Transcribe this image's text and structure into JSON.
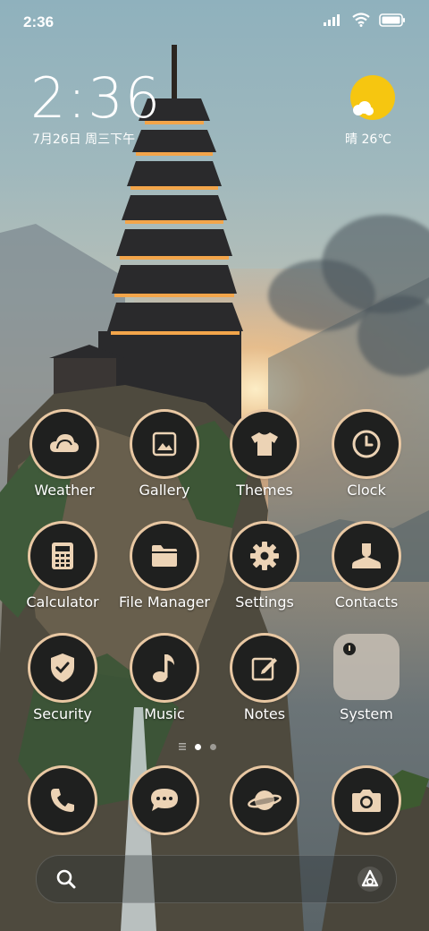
{
  "status_bar": {
    "time": "2:36",
    "signal": "signal-icon",
    "wifi": "wifi-icon",
    "battery": "battery-icon"
  },
  "clock_widget": {
    "time": "2:36",
    "date": "7月26日 周三下午"
  },
  "weather_widget": {
    "condition_icon": "sun-cloud-icon",
    "text": "晴 26℃"
  },
  "apps_row1": [
    {
      "label": "Weather",
      "icon": "weather-cloud-icon"
    },
    {
      "label": "Gallery",
      "icon": "gallery-icon"
    },
    {
      "label": "Themes",
      "icon": "tshirt-icon"
    },
    {
      "label": "Clock",
      "icon": "clock-icon"
    }
  ],
  "apps_row2": [
    {
      "label": "Calculator",
      "icon": "calculator-icon"
    },
    {
      "label": "File Manager",
      "icon": "folder-icon"
    },
    {
      "label": "Settings",
      "icon": "gear-icon"
    },
    {
      "label": "Contacts",
      "icon": "contact-icon"
    }
  ],
  "apps_row3": [
    {
      "label": "Security",
      "icon": "shield-check-icon"
    },
    {
      "label": "Music",
      "icon": "music-note-icon"
    },
    {
      "label": "Notes",
      "icon": "notes-pen-icon"
    },
    {
      "label": "System",
      "icon": "folder-system-icon"
    }
  ],
  "page_indicator": {
    "current_page": 2,
    "pages": 3
  },
  "dock": [
    {
      "icon": "phone-icon"
    },
    {
      "icon": "messages-icon"
    },
    {
      "icon": "browser-planet-icon"
    },
    {
      "icon": "camera-icon"
    }
  ],
  "search": {
    "icon": "search-icon",
    "assistant_icon": "assistant-icon"
  },
  "colors": {
    "icon_ring": "#e9c8a3",
    "icon_bg": "#1f201f",
    "sun": "#f6c610"
  }
}
